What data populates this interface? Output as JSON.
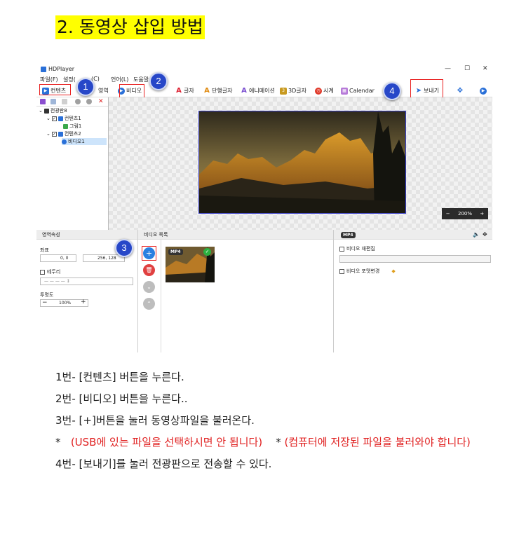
{
  "heading": "2. 동영상 삽입 방법",
  "screenshot": {
    "app_title": "HDPlayer",
    "window_controls": [
      "—",
      "☐",
      "✕"
    ],
    "menu": [
      "파일(F)",
      "설정(",
      "(C)",
      "언어(L)",
      "도움말"
    ],
    "toolbar": {
      "content": "컨텐츠",
      "area": "영역",
      "video": "비디오",
      "text": "글자",
      "single_text": "단행글자",
      "animation": "애니메이션",
      "text3d": "3D글자",
      "clock": "시계",
      "calendar": "Calendar",
      "send": "보내기"
    },
    "badges": [
      "1",
      "2",
      "3",
      "4"
    ],
    "tree": {
      "root": "전광판8",
      "items": [
        "컨텐츠1",
        "그림1",
        "컨텐츠2",
        "비디오1"
      ]
    },
    "zoom": {
      "minus": "−",
      "value": "200%",
      "plus": "+"
    },
    "props": {
      "title": "영역속성",
      "coords_label": "좌표",
      "x": "0, 0",
      "y": "256, 128",
      "border_label": "테두리",
      "border_value": "— — — —  ↕",
      "opacity_label": "투명도",
      "opacity_value": "100%",
      "opacity_minus": "−",
      "opacity_plus": "+"
    },
    "video_list": {
      "title": "비디오 목록",
      "add": "+",
      "tag": "MP4"
    },
    "right": {
      "tag": "MP4",
      "option1": "비디오 재편집",
      "option2": "비디오 포맷변경"
    }
  },
  "instructions": {
    "line1": "1번- [컨텐츠] 버튼을 누른다.",
    "line2": "2번- [비디오] 버튼을 누른다..",
    "line3": "3번- [+]버튼을 눌러 동영상파일을 불러온다.",
    "star1": "*",
    "note1": "(USB에 있는 파일을 선택하시면 안 됩니다)",
    "star2": "*",
    "note2": "(컴퓨터에 저장된 파일을 불러와야 합니다)",
    "line4": "4번- [보내기]를 눌러 전광판으로 전송할 수 있다."
  },
  "colors": {
    "highlight": "#ffff00",
    "badge": "#2747c8",
    "callout_box": "#e82020",
    "note_text": "#e02020"
  }
}
